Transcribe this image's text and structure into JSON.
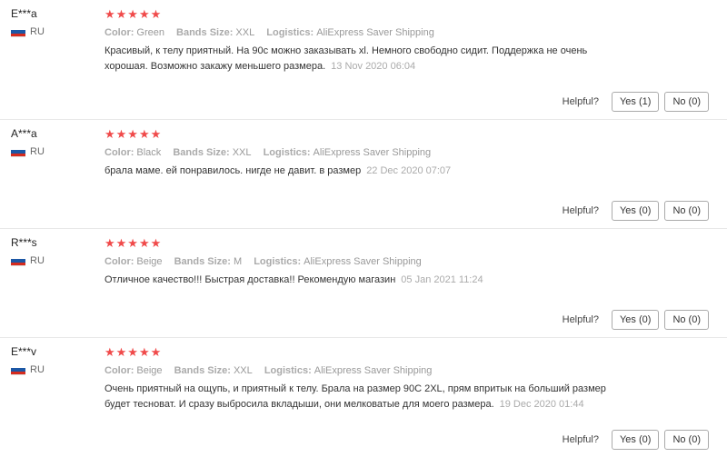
{
  "reviews": [
    {
      "name": "E***a",
      "country": "RU",
      "stars": "★★★★★",
      "color_key": "Color:",
      "color": "Green",
      "size_key": "Bands Size:",
      "size": "XXL",
      "logistics_key": "Logistics:",
      "logistics": "AliExpress Saver Shipping",
      "text": "Красивый, к телу приятный. На 90с можно заказывать xl. Немного свободно сидит. Поддержка не очень хорошая. Возможно закажу меньшего размера.",
      "date": "13 Nov 2020 06:04",
      "helpful": "Helpful?",
      "yes": "Yes (1)",
      "no": "No (0)"
    },
    {
      "name": "A***a",
      "country": "RU",
      "stars": "★★★★★",
      "color_key": "Color:",
      "color": "Black",
      "size_key": "Bands Size:",
      "size": "XXL",
      "logistics_key": "Logistics:",
      "logistics": "AliExpress Saver Shipping",
      "text": "брала маме. ей понравилось. нигде не давит. в размер",
      "date": "22 Dec 2020 07:07",
      "helpful": "Helpful?",
      "yes": "Yes (0)",
      "no": "No (0)"
    },
    {
      "name": "R***s",
      "country": "RU",
      "stars": "★★★★★",
      "color_key": "Color:",
      "color": "Beige",
      "size_key": "Bands Size:",
      "size": "M",
      "logistics_key": "Logistics:",
      "logistics": "AliExpress Saver Shipping",
      "text": "Отличное качество!!! Быстрая доставка!! Рекомендую магазин",
      "date": "05 Jan 2021 11:24",
      "helpful": "Helpful?",
      "yes": "Yes (0)",
      "no": "No (0)"
    },
    {
      "name": "E***v",
      "country": "RU",
      "stars": "★★★★★",
      "color_key": "Color:",
      "color": "Beige",
      "size_key": "Bands Size:",
      "size": "XXL",
      "logistics_key": "Logistics:",
      "logistics": "AliExpress Saver Shipping",
      "text": "Очень приятный на ощупь, и приятный к телу. Брала на размер 90С 2XL, прям впритык на больший размер будет тесноват. И сразу выбросила вкладыши, они мелковатые для моего размера.",
      "date": "19 Dec 2020 01:44",
      "helpful": "Helpful?",
      "yes": "Yes (0)",
      "no": "No (0)"
    }
  ],
  "colors": {
    "star": "#f04a4a",
    "flag_white": "#ffffff",
    "flag_blue": "#1c57a5",
    "flag_red": "#d52b1e"
  }
}
